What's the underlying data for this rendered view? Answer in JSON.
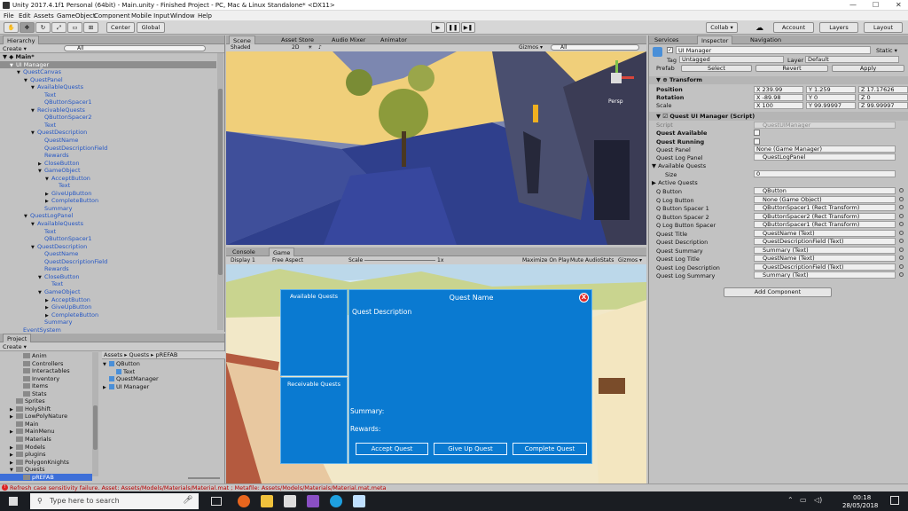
{
  "window": {
    "title": "Unity 2017.4.1f1 Personal (64bit) - Main.unity - Finished Project - PC, Mac & Linux Standalone* <DX11>"
  },
  "menu": [
    "File",
    "Edit",
    "Assets",
    "GameObject",
    "Component",
    "Mobile Input",
    "Window",
    "Help"
  ],
  "toolbar": {
    "center": "Center",
    "global": "Global",
    "collab": "Collab ▾",
    "account": "Account",
    "layers": "Layers",
    "layout": "Layout"
  },
  "hierarchy": {
    "tab": "Hierarchy",
    "create": "Create ▾",
    "search": "All",
    "scene": "Main*",
    "items": [
      {
        "label": "UI Manager",
        "indent": 1,
        "selected": true,
        "arrow": "▼",
        "blue": false
      },
      {
        "label": "QuestCanvas",
        "indent": 2,
        "arrow": "▼",
        "blue": true
      },
      {
        "label": "QuestPanel",
        "indent": 3,
        "arrow": "▼",
        "blue": true
      },
      {
        "label": "AvailableQuests",
        "indent": 4,
        "arrow": "▼",
        "blue": true
      },
      {
        "label": "Text",
        "indent": 5,
        "arrow": "",
        "blue": true
      },
      {
        "label": "QButtonSpacer1",
        "indent": 5,
        "arrow": "",
        "blue": true
      },
      {
        "label": "RecivableQuests",
        "indent": 4,
        "arrow": "▼",
        "blue": true
      },
      {
        "label": "QButtonSpacer2",
        "indent": 5,
        "arrow": "",
        "blue": true
      },
      {
        "label": "Text",
        "indent": 5,
        "arrow": "",
        "blue": true
      },
      {
        "label": "QuestDescription",
        "indent": 4,
        "arrow": "▼",
        "blue": true
      },
      {
        "label": "QuestName",
        "indent": 5,
        "arrow": "",
        "blue": true
      },
      {
        "label": "QuestDescriptionField",
        "indent": 5,
        "arrow": "",
        "blue": true
      },
      {
        "label": "Rewards",
        "indent": 5,
        "arrow": "",
        "blue": true
      },
      {
        "label": "CloseButton",
        "indent": 5,
        "arrow": "▶",
        "blue": true
      },
      {
        "label": "GameObject",
        "indent": 5,
        "arrow": "▼",
        "blue": true
      },
      {
        "label": "AcceptButton",
        "indent": 6,
        "arrow": "▼",
        "blue": true
      },
      {
        "label": "Text",
        "indent": 7,
        "arrow": "",
        "blue": true
      },
      {
        "label": "GiveUpButton",
        "indent": 6,
        "arrow": "▶",
        "blue": true
      },
      {
        "label": "CompleteButton",
        "indent": 6,
        "arrow": "▶",
        "blue": true
      },
      {
        "label": "Summary",
        "indent": 5,
        "arrow": "",
        "blue": true
      },
      {
        "label": "QuestLogPanel",
        "indent": 3,
        "arrow": "▼",
        "blue": true
      },
      {
        "label": "AvailableQuests",
        "indent": 4,
        "arrow": "▼",
        "blue": true
      },
      {
        "label": "Text",
        "indent": 5,
        "arrow": "",
        "blue": true
      },
      {
        "label": "QButtonSpacer1",
        "indent": 5,
        "arrow": "",
        "blue": true
      },
      {
        "label": "QuestDescription",
        "indent": 4,
        "arrow": "▼",
        "blue": true
      },
      {
        "label": "QuestName",
        "indent": 5,
        "arrow": "",
        "blue": true
      },
      {
        "label": "QuestDescriptionField",
        "indent": 5,
        "arrow": "",
        "blue": true
      },
      {
        "label": "Rewards",
        "indent": 5,
        "arrow": "",
        "blue": true
      },
      {
        "label": "CloseButton",
        "indent": 5,
        "arrow": "▼",
        "blue": true
      },
      {
        "label": "Text",
        "indent": 6,
        "arrow": "",
        "blue": true
      },
      {
        "label": "GameObject",
        "indent": 5,
        "arrow": "▼",
        "blue": true
      },
      {
        "label": "AcceptButton",
        "indent": 6,
        "arrow": "▶",
        "blue": true
      },
      {
        "label": "GiveUpButton",
        "indent": 6,
        "arrow": "▶",
        "blue": true
      },
      {
        "label": "CompleteButton",
        "indent": 6,
        "arrow": "▶",
        "blue": true
      },
      {
        "label": "Summary",
        "indent": 5,
        "arrow": "",
        "blue": true
      },
      {
        "label": "EventSystem",
        "indent": 2,
        "arrow": "",
        "blue": true
      }
    ]
  },
  "project": {
    "tab": "Project",
    "create": "Create ▾",
    "folders": [
      {
        "label": "Anim",
        "indent": 2
      },
      {
        "label": "Controllers",
        "indent": 2
      },
      {
        "label": "Interactables",
        "indent": 2
      },
      {
        "label": "Inventory",
        "indent": 2
      },
      {
        "label": "Items",
        "indent": 2
      },
      {
        "label": "Stats",
        "indent": 2
      },
      {
        "label": "Sprites",
        "indent": 1
      },
      {
        "label": "HolyShift",
        "indent": 1,
        "arrow": "▶"
      },
      {
        "label": "LowPolyNature",
        "indent": 1,
        "arrow": "▶"
      },
      {
        "label": "Main",
        "indent": 1
      },
      {
        "label": "MainMenu",
        "indent": 1,
        "arrow": "▶"
      },
      {
        "label": "Materials",
        "indent": 1
      },
      {
        "label": "Models",
        "indent": 1,
        "arrow": "▶"
      },
      {
        "label": "plugins",
        "indent": 1,
        "arrow": "▶"
      },
      {
        "label": "PolygonKnights",
        "indent": 1,
        "arrow": "▶"
      },
      {
        "label": "Quests",
        "indent": 1,
        "arrow": "▼"
      },
      {
        "label": "pREFAB",
        "indent": 2,
        "selected": true
      }
    ],
    "breadcrumb": "Assets ▸ Quests ▸ pREFAB",
    "assets": [
      {
        "label": "QButton",
        "indent": 0,
        "arrow": "▼"
      },
      {
        "label": "Text",
        "indent": 1
      },
      {
        "label": "QuestManager",
        "indent": 0
      },
      {
        "label": "UI Manager",
        "indent": 0,
        "arrow": "▶"
      }
    ]
  },
  "scene": {
    "tabs": [
      "Scene",
      "Asset Store",
      "Audio Mixer",
      "Animator"
    ],
    "shading": "Shaded",
    "mode2d": "2D",
    "gizmos": "Gizmos ▾",
    "search": "All",
    "persp": "Persp"
  },
  "game": {
    "tabs": [
      "Console",
      "Game"
    ],
    "display": "Display 1",
    "aspect": "Free Aspect",
    "scale_label": "Scale",
    "scale_value": "1x",
    "toggles": [
      "Maximize On Play",
      "Mute Audio",
      "Stats",
      "Gizmos ▾"
    ]
  },
  "quest_ui": {
    "available": "Available Quests",
    "receivable": "Receivable Quests",
    "name": "Quest Name",
    "description": "Quest Description",
    "summary": "Summary:",
    "rewards": "Rewards:",
    "close": "X",
    "accept": "Accept Quest",
    "giveup": "Give Up Quest",
    "complete": "Complete Quest"
  },
  "inspector": {
    "tabs": [
      "Services",
      "Inspector",
      "Navigation"
    ],
    "object_name": "UI Manager",
    "static": "Static ▾",
    "tag_label": "Tag",
    "tag_value": "Untagged",
    "layer_label": "Layer",
    "layer_value": "Default",
    "prefab_label": "Prefab",
    "prefab_select": "Select",
    "prefab_revert": "Revert",
    "prefab_apply": "Apply",
    "transform_title": "Transform",
    "position_label": "Position",
    "rotation_label": "Rotation",
    "scale_label": "Scale",
    "position": [
      "X 239.99",
      "Y 1.259",
      "Z 17.17626"
    ],
    "rotation": [
      "X -89.98",
      "Y 0",
      "Z 0"
    ],
    "scale": [
      "X 100",
      "Y 99.99997",
      "Z 99.99997"
    ],
    "component_title": "Quest UI Manager (Script)",
    "script_label": "Script",
    "script_value": "QuestUIManager",
    "quest_available": "Quest Available",
    "quest_running": "Quest Running",
    "fields": [
      {
        "label": "Quest Panel",
        "value": "None (Game Manager)"
      },
      {
        "label": "Quest Log Panel",
        "value": "QuestLogPanel"
      }
    ],
    "available_quests": "Available Quests",
    "size_label": "Size",
    "size_value": "0",
    "active_quests": "Active Quests",
    "refs": [
      {
        "label": "Q Button",
        "value": "QButton"
      },
      {
        "label": "Q Log Button",
        "value": "None (Game Object)"
      },
      {
        "label": "Q Button Spacer 1",
        "value": "QButtonSpacer1 (Rect Transform)"
      },
      {
        "label": "Q Button Spacer 2",
        "value": "QButtonSpacer2 (Rect Transform)"
      },
      {
        "label": "Q Log Button Spacer",
        "value": "QButtonSpacer1 (Rect Transform)"
      },
      {
        "label": "Quest Title",
        "value": "QuestName (Text)"
      },
      {
        "label": "Quest Description",
        "value": "QuestDescriptionField (Text)"
      },
      {
        "label": "Quest Summary",
        "value": "Summary (Text)"
      },
      {
        "label": "Quest Log Title",
        "value": "QuestName (Text)"
      },
      {
        "label": "Quest Log Description",
        "value": "QuestDescriptionField (Text)"
      },
      {
        "label": "Quest Log Summary",
        "value": "Summary (Text)"
      }
    ],
    "add_component": "Add Component"
  },
  "status": {
    "message": "Refresh case sensitivity failure. Asset: Assets/Models/Materials/Material.mat ; Metafile: Assets/Models/Materials/Material.mat.meta"
  },
  "taskbar": {
    "search": "Type here to search",
    "time": "00:18",
    "date": "28/05/2018"
  }
}
